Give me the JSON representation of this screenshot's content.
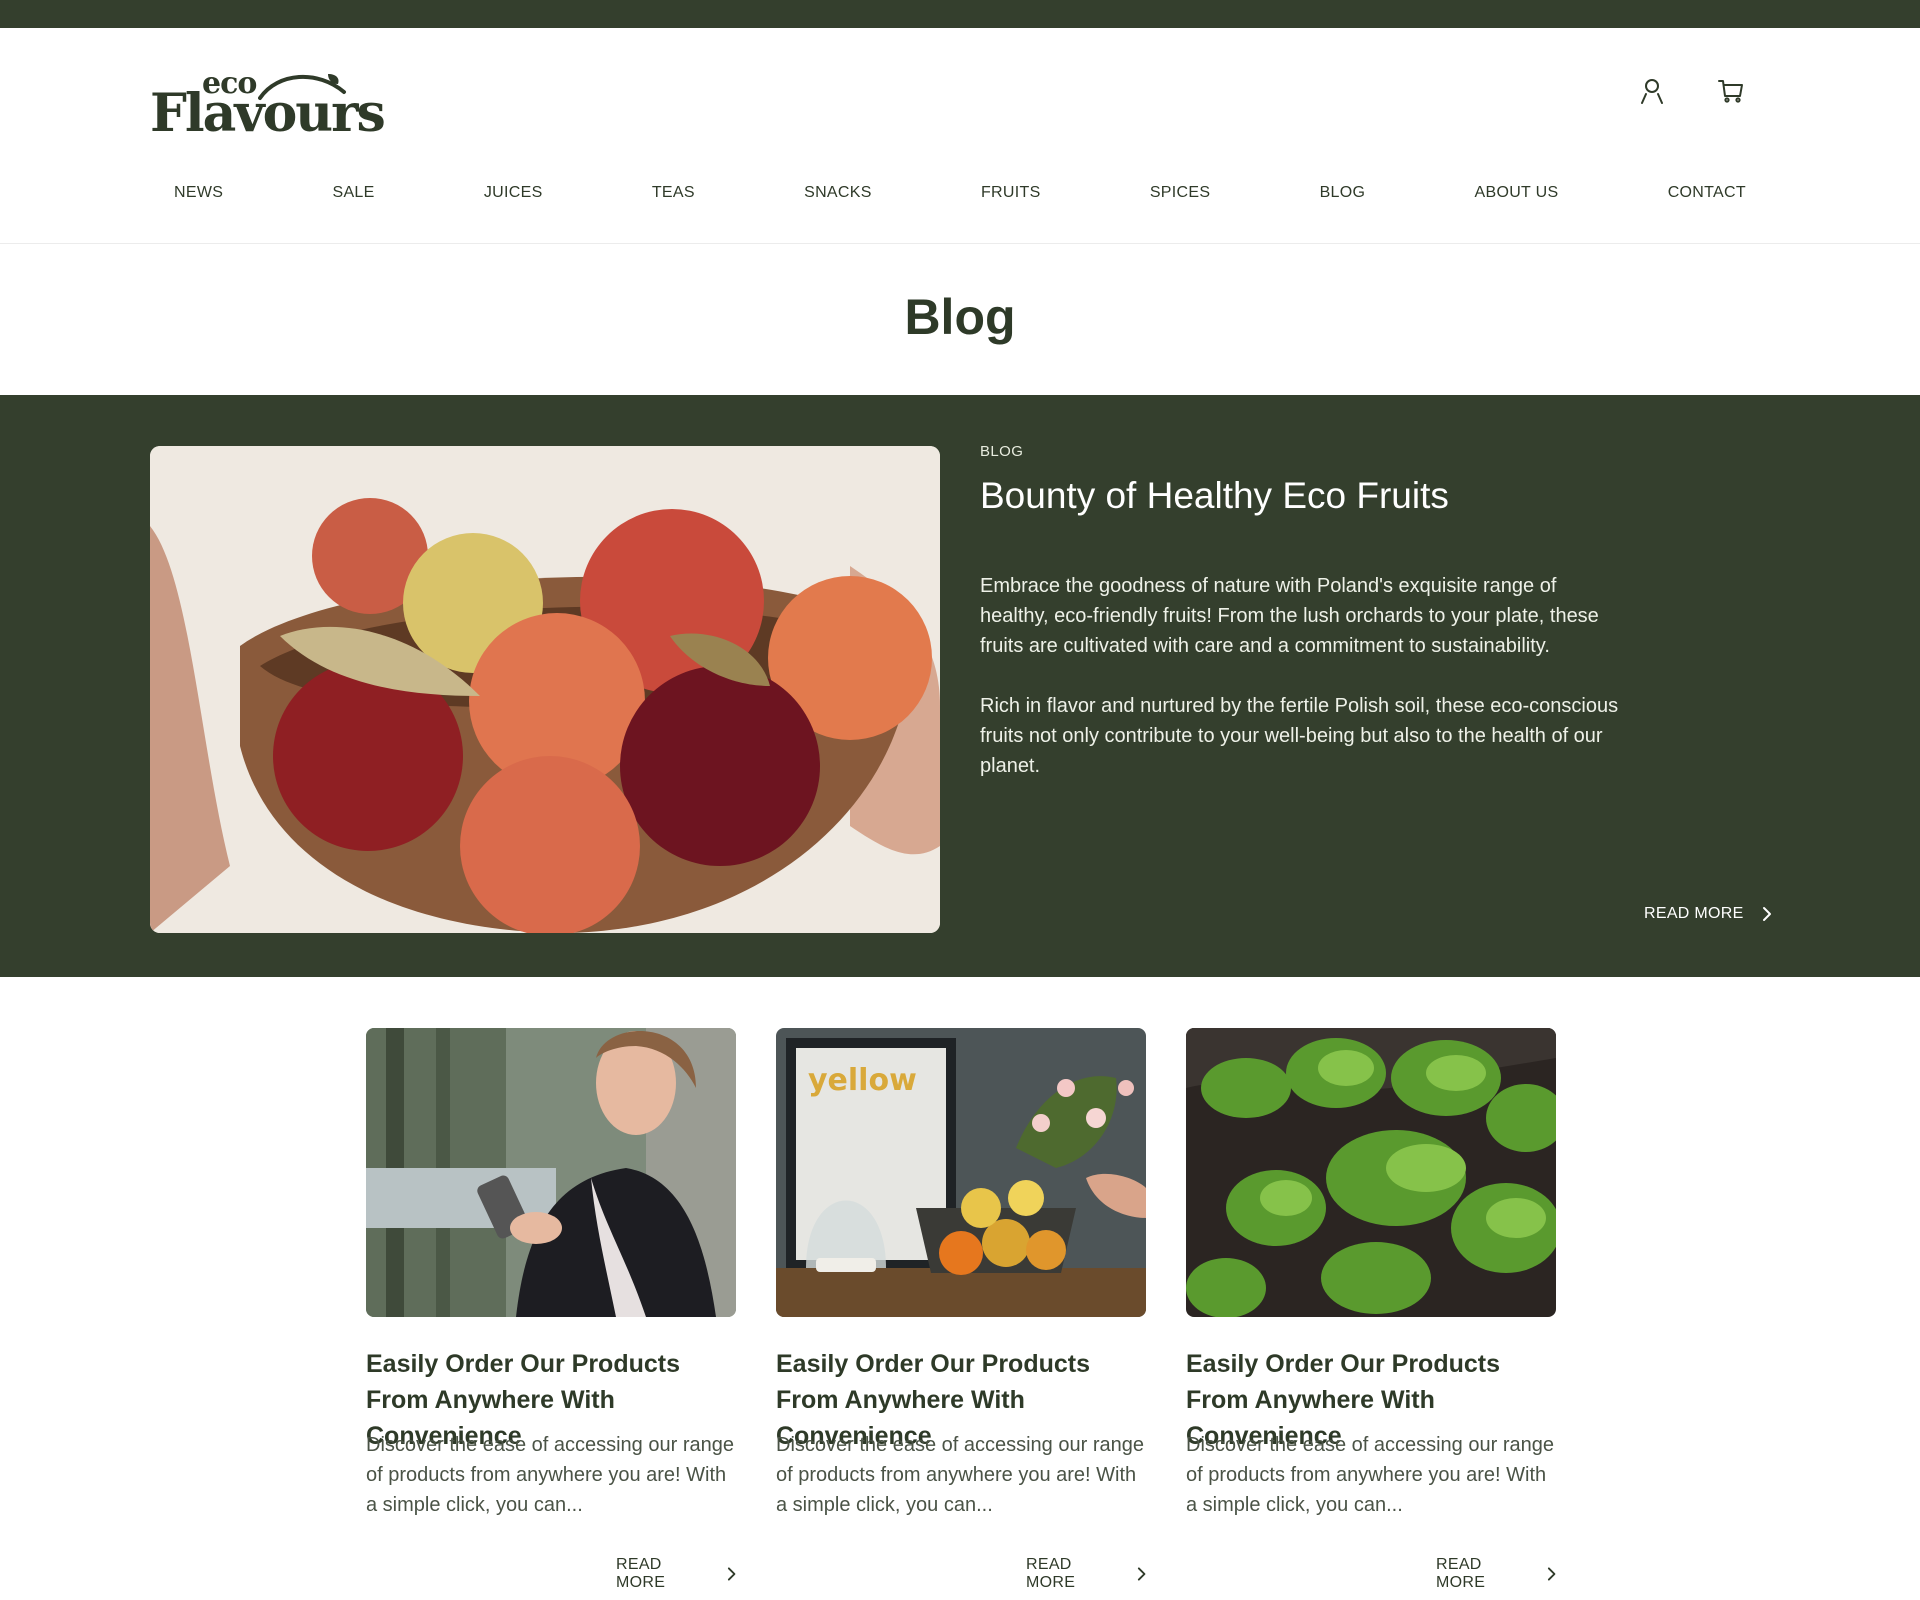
{
  "brand": {
    "logo_top": "eco",
    "logo_main": "Flavours"
  },
  "header": {
    "icons": [
      "user-icon",
      "cart-icon"
    ]
  },
  "nav": {
    "items": [
      "NEWS",
      "SALE",
      "JUICES",
      "TEAS",
      "SNACKS",
      "FRUITS",
      "SPICES",
      "BLOG",
      "ABOUT US",
      "CONTACT"
    ]
  },
  "page": {
    "title": "Blog"
  },
  "featured": {
    "category": "BLOG",
    "title": "Bounty of Healthy Eco Fruits",
    "paragraph_1": "Embrace the goodness of nature with Poland's exquisite range of healthy, eco-friendly fruits! From the lush orchards to your plate, these fruits are cultivated with care and a commitment to sustainability.",
    "paragraph_2": "Rich in flavor and nurtured by the fertile Polish soil, these eco-conscious fruits not only contribute to your well-being but also to the health of our planet.",
    "read_more": "READ MORE",
    "image": "bowl-of-apples-photo"
  },
  "posts": [
    {
      "title": "Easily Order Our Products From Anywhere With Convenience",
      "excerpt": "Discover the ease of accessing our range of products from anywhere you are! With a simple click, you can...",
      "read_more": "READ MORE",
      "image": "woman-with-phone-photo"
    },
    {
      "title": "Easily Order Our Products From Anywhere With Convenience",
      "excerpt": "Discover the ease of accessing our range of products from anywhere you are! With a simple click, you can...",
      "read_more": "READ MORE",
      "image": "fruit-basket-photo",
      "image_text": "yellow"
    },
    {
      "title": "Easily Order Our Products From Anywhere With Convenience",
      "excerpt": "Discover the ease of accessing our range of products from anywhere you are! With a simple click, you can...",
      "read_more": "READ MORE",
      "image": "lettuce-sprouts-photo"
    }
  ],
  "colors": {
    "brand_dark_green": "#343f2d",
    "text_dark": "#2e3a28",
    "white": "#ffffff"
  }
}
